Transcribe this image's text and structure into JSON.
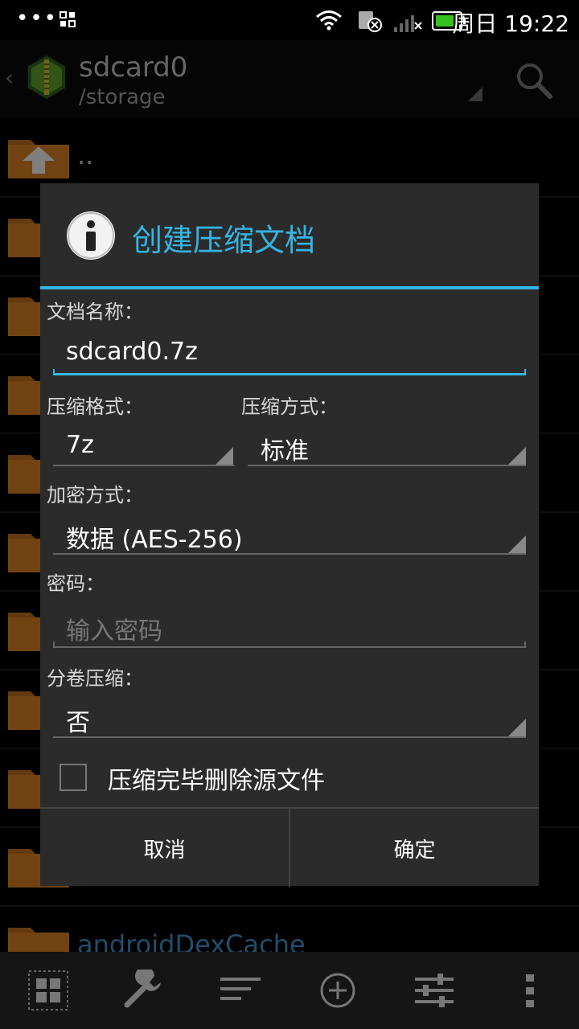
{
  "status_bar": {
    "dots": "•••",
    "time": "周日 19:22",
    "battery_level": 0.85,
    "colors": {
      "battery": "#35c21f"
    }
  },
  "action_bar": {
    "title": "sdcard0",
    "subtitle": "/storage",
    "back_icon": "chevron-left-icon",
    "logo_icon": "7zip-archive-logo-icon",
    "search_icon": "search-icon"
  },
  "file_list": {
    "items": [
      {
        "name": "..",
        "icon": "folder-up-icon"
      },
      {
        "name": "",
        "icon": "folder-icon"
      },
      {
        "name": "",
        "icon": "folder-icon"
      },
      {
        "name": "",
        "icon": "folder-icon"
      },
      {
        "name": "",
        "icon": "folder-icon"
      },
      {
        "name": "",
        "icon": "folder-icon"
      },
      {
        "name": "",
        "icon": "folder-icon"
      },
      {
        "name": "",
        "icon": "folder-icon"
      },
      {
        "name": "",
        "icon": "folder-icon"
      },
      {
        "name": "",
        "icon": "folder-icon"
      },
      {
        "name": "androidDexCache",
        "icon": "folder-icon"
      }
    ]
  },
  "dialog": {
    "title": "创建压缩文档",
    "title_icon": "info-icon",
    "accent_color": "#33b5e5",
    "archive_name_label": "文档名称：",
    "archive_name_value": "sdcard0.7z",
    "format_label": "压缩格式：",
    "format_value": "7z",
    "level_label": "压缩方式：",
    "level_value": "标准",
    "encryption_label": "加密方式：",
    "encryption_value": "数据 (AES-256)",
    "password_label": "密码：",
    "password_placeholder": "输入密码",
    "split_label": "分卷压缩：",
    "split_value": "否",
    "delete_source_label": "压缩完毕删除源文件",
    "delete_source_checked": false,
    "cancel_label": "取消",
    "ok_label": "确定"
  },
  "toolbar": {
    "icons": [
      "grid-select-icon",
      "wrench-icon",
      "sort-icon",
      "add-circle-icon",
      "sliders-icon",
      "more-vert-icon"
    ]
  }
}
